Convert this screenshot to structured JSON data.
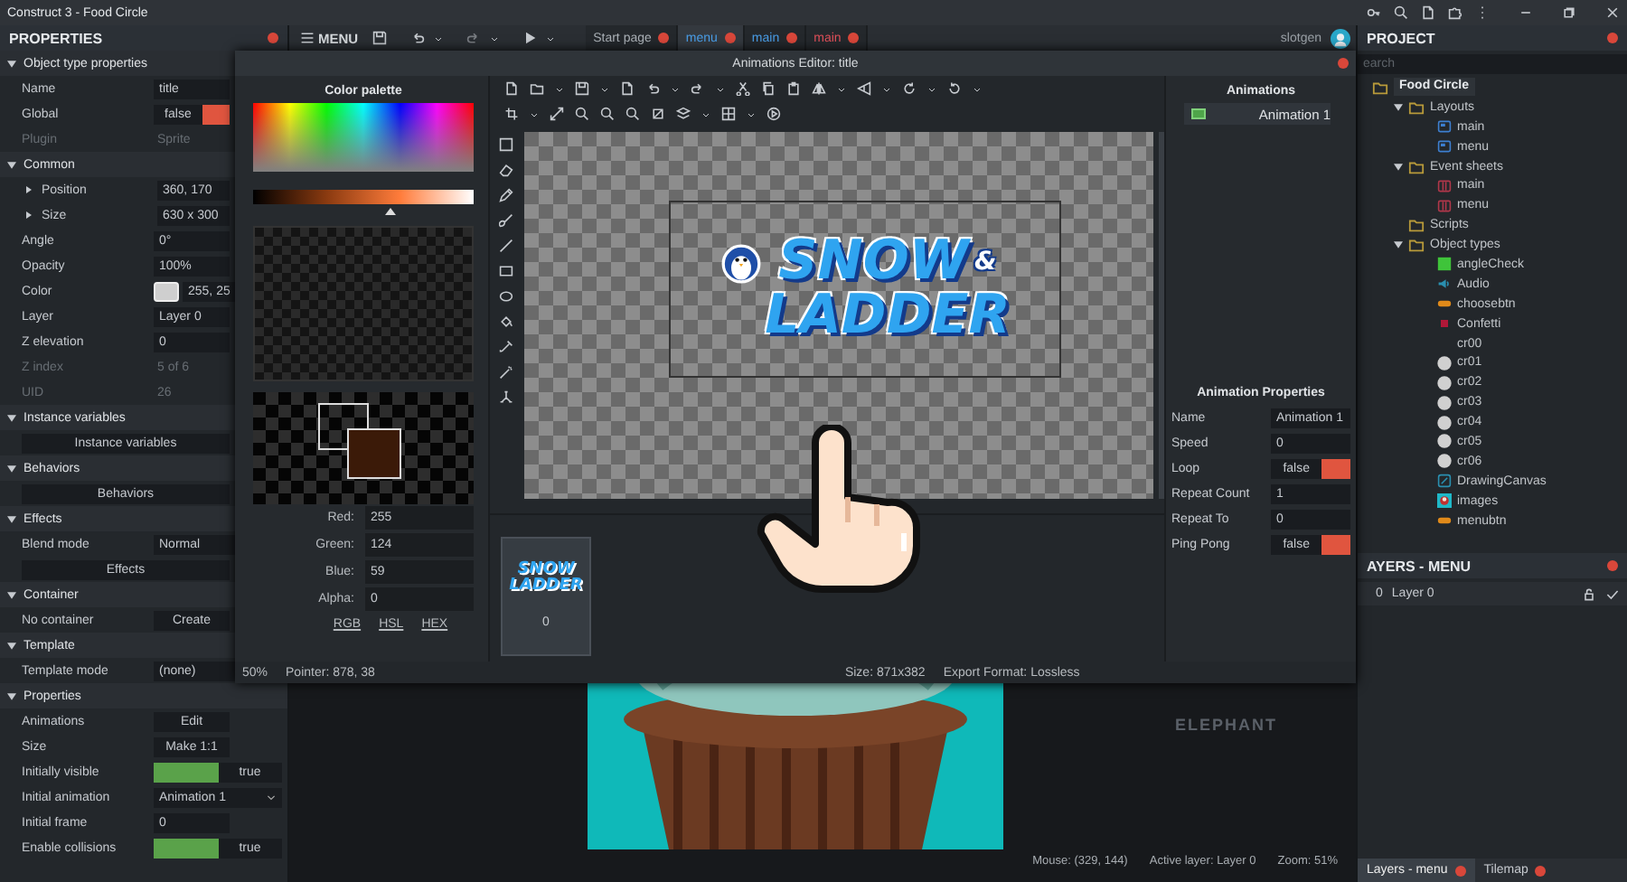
{
  "window": {
    "title": "Construct 3 - Food Circle"
  },
  "properties": {
    "title": "PROPERTIES",
    "sections": [
      {
        "title": "Object type properties",
        "expanded": true,
        "rows": [
          {
            "kind": "text",
            "label": "Name",
            "value": "title"
          },
          {
            "kind": "toggle",
            "label": "Global",
            "value": "false",
            "on": false
          },
          {
            "kind": "readonly",
            "label": "Plugin",
            "value": "Sprite"
          }
        ]
      },
      {
        "title": "Common",
        "expanded": true,
        "rows": [
          {
            "kind": "group",
            "label": "Position",
            "value": "360, 170",
            "expanded": false
          },
          {
            "kind": "group",
            "label": "Size",
            "value": "630 x 300",
            "expanded": false
          },
          {
            "kind": "text",
            "label": "Angle",
            "value": "0°"
          },
          {
            "kind": "text",
            "label": "Opacity",
            "value": "100%"
          },
          {
            "kind": "color",
            "label": "Color",
            "value": "255, 25"
          },
          {
            "kind": "text",
            "label": "Layer",
            "value": "Layer 0"
          },
          {
            "kind": "text",
            "label": "Z elevation",
            "value": "0"
          },
          {
            "kind": "readonly",
            "label": "Z index",
            "value": "5 of 6"
          },
          {
            "kind": "readonly",
            "label": "UID",
            "value": "26"
          }
        ]
      },
      {
        "title": "Instance variables",
        "expanded": true,
        "rows": [
          {
            "kind": "button",
            "value": "Instance variables"
          }
        ]
      },
      {
        "title": "Behaviors",
        "expanded": true,
        "rows": [
          {
            "kind": "button",
            "value": "Behaviors"
          }
        ]
      },
      {
        "title": "Effects",
        "expanded": true,
        "rows": [
          {
            "kind": "select",
            "label": "Blend mode",
            "value": "Normal"
          },
          {
            "kind": "button",
            "value": "Effects"
          }
        ]
      },
      {
        "title": "Container",
        "expanded": true,
        "rows": [
          {
            "kind": "action",
            "label": "No container",
            "value": "Create"
          }
        ]
      },
      {
        "title": "Template",
        "expanded": true,
        "rows": [
          {
            "kind": "select",
            "label": "Template mode",
            "value": "(none)"
          }
        ]
      },
      {
        "title": "Properties",
        "expanded": true,
        "rows": [
          {
            "kind": "action",
            "label": "Animations",
            "value": "Edit"
          },
          {
            "kind": "action",
            "label": "Size",
            "value": "Make 1:1"
          },
          {
            "kind": "toggle",
            "label": "Initially visible",
            "value": "true",
            "on": true
          },
          {
            "kind": "select",
            "label": "Initial animation",
            "value": "Animation 1"
          },
          {
            "kind": "text",
            "label": "Initial frame",
            "value": "0"
          },
          {
            "kind": "toggle",
            "label": "Enable collisions",
            "value": "true",
            "on": true
          }
        ]
      }
    ]
  },
  "toolbar": {
    "menu_label": "MENU",
    "tabs": [
      {
        "label": "Start page",
        "kind": "page",
        "selected": false
      },
      {
        "label": "menu",
        "kind": "layout",
        "selected": true
      },
      {
        "label": "main",
        "kind": "layout",
        "selected": false
      },
      {
        "label": "main",
        "kind": "events",
        "selected": false
      }
    ],
    "user": "slotgen"
  },
  "layout_view": {
    "text": "ELEPHANT"
  },
  "status_bar": {
    "mouse": "Mouse: (329, 144)",
    "active_layer": "Active layer: Layer 0",
    "zoom": "Zoom: 51%"
  },
  "project": {
    "title": "PROJECT",
    "search": {
      "placeholder": "earch"
    },
    "tree": [
      {
        "label": "Food Circle",
        "kind": "root",
        "children": [
          {
            "label": "Layouts",
            "kind": "folder",
            "expanded": true,
            "children": [
              {
                "label": "main",
                "kind": "layout"
              },
              {
                "label": "menu",
                "kind": "layout"
              }
            ]
          },
          {
            "label": "Event sheets",
            "kind": "folder",
            "expanded": true,
            "children": [
              {
                "label": "main",
                "kind": "event_sheet"
              },
              {
                "label": "menu",
                "kind": "event_sheet"
              }
            ]
          },
          {
            "label": "Scripts",
            "kind": "leaf_folder"
          },
          {
            "label": "Object types",
            "kind": "folder",
            "expanded": true,
            "children": [
              {
                "label": "angleCheck",
                "kind": "sprite"
              },
              {
                "label": "Audio",
                "kind": "audio"
              },
              {
                "label": "choosebtn",
                "kind": "button"
              },
              {
                "label": "Confetti",
                "kind": "particles"
              },
              {
                "label": "cr00",
                "kind": "blank"
              },
              {
                "label": "cr01",
                "kind": "circle"
              },
              {
                "label": "cr02",
                "kind": "circle"
              },
              {
                "label": "cr03",
                "kind": "circle"
              },
              {
                "label": "cr04",
                "kind": "circle"
              },
              {
                "label": "cr05",
                "kind": "circle"
              },
              {
                "label": "cr06",
                "kind": "circle"
              },
              {
                "label": "DrawingCanvas",
                "kind": "drawing_canvas"
              },
              {
                "label": "images",
                "kind": "image"
              },
              {
                "label": "menubtn",
                "kind": "button"
              }
            ]
          }
        ]
      }
    ]
  },
  "layers": {
    "title": "AYERS - MENU",
    "rows": [
      {
        "index": "0",
        "name": "Layer 0"
      }
    ]
  },
  "bottom_tabs": [
    {
      "label": "Layers - menu",
      "selected": true
    },
    {
      "label": "Tilemap",
      "selected": false
    }
  ],
  "dialog": {
    "title": "Animations Editor: title",
    "palette": {
      "title": "Color palette",
      "hue": {
        "level": 0.62
      },
      "channels": [
        {
          "label": "Red:",
          "value": "255"
        },
        {
          "label": "Green:",
          "value": "124"
        },
        {
          "label": "Blue:",
          "value": "59"
        },
        {
          "label": "Alpha:",
          "value": "0"
        }
      ],
      "modes": [
        "RGB",
        "HSL",
        "HEX"
      ]
    },
    "zoom": "50%",
    "pointer": "Pointer: 878, 38",
    "size": "Size: 871x382",
    "export_format": "Export Format: Lossless",
    "logo": {
      "lines": [
        "SNOW",
        "&",
        "LADDER"
      ]
    },
    "frames": [
      {
        "label": "0",
        "selected": true,
        "logo_lines": [
          "SNOW",
          "LADDER"
        ]
      }
    ],
    "animations": {
      "title": "Animations",
      "items": [
        {
          "label": "Animation 1",
          "selected": true
        }
      ]
    },
    "animation_properties": {
      "title": "Animation Properties",
      "rows": [
        {
          "kind": "text",
          "label": "Name",
          "value": "Animation 1"
        },
        {
          "kind": "text",
          "label": "Speed",
          "value": "0"
        },
        {
          "kind": "toggle",
          "label": "Loop",
          "value": "false",
          "on": false
        },
        {
          "kind": "text",
          "label": "Repeat Count",
          "value": "1"
        },
        {
          "kind": "text",
          "label": "Repeat To",
          "value": "0"
        },
        {
          "kind": "toggle",
          "label": "Ping Pong",
          "value": "false",
          "on": false
        }
      ]
    }
  }
}
